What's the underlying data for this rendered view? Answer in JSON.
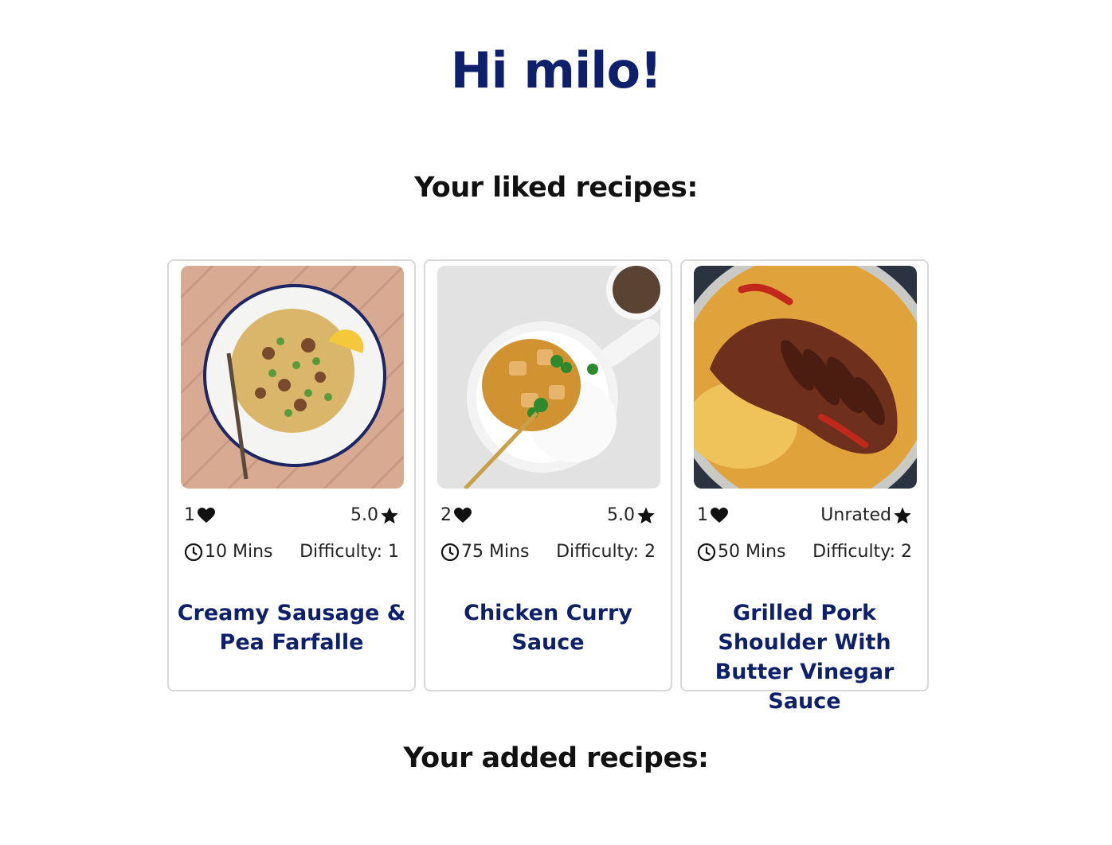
{
  "greeting": "Hi milo!",
  "liked_heading": "Your liked recipes:",
  "added_heading": "Your added recipes:",
  "colors": {
    "brand_navy": "#0e1f6b",
    "card_border": "#d8d8d8"
  },
  "icons": {
    "likes": "heart-icon",
    "rating": "star-icon",
    "time": "clock-icon"
  },
  "recipes": [
    {
      "likes": "1",
      "rating": "5.0",
      "time": "10 Mins",
      "difficulty": "Difficulty: 1",
      "title": "Creamy Sausage & Pea Farfalle"
    },
    {
      "likes": "2",
      "rating": "5.0",
      "time": "75 Mins",
      "difficulty": "Difficulty: 2",
      "title": "Chicken Curry Sauce"
    },
    {
      "likes": "1",
      "rating": "Unrated",
      "time": "50 Mins",
      "difficulty": "Difficulty: 2",
      "title": "Grilled Pork Shoulder With Butter Vinegar Sauce"
    }
  ]
}
